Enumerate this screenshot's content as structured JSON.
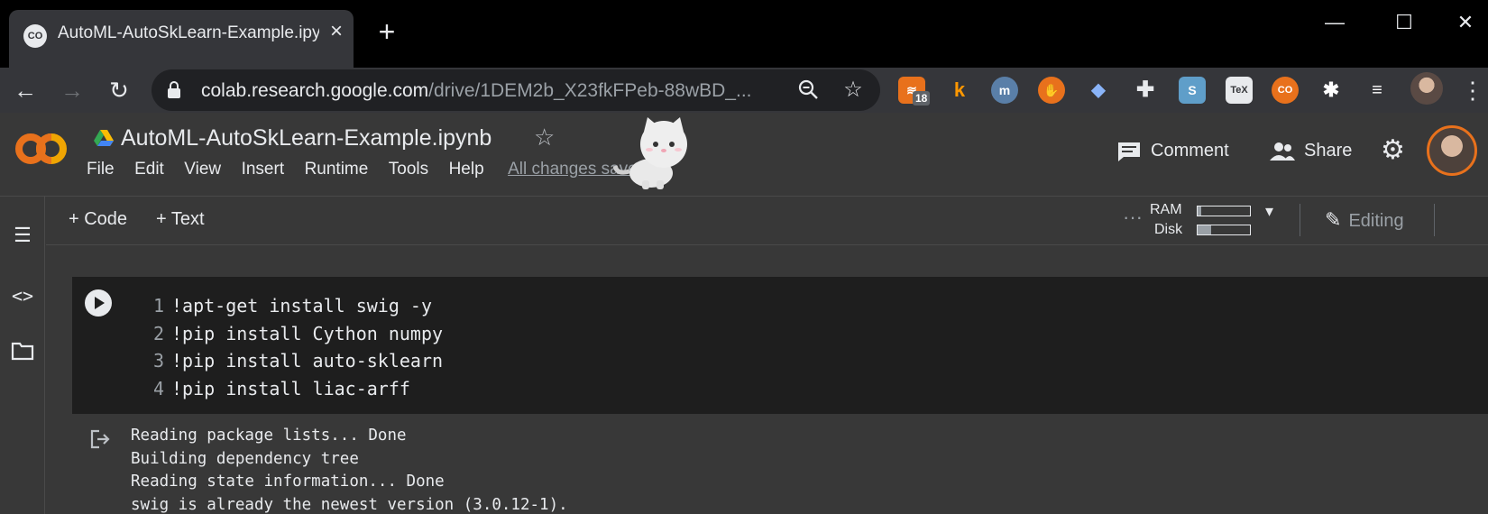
{
  "browser": {
    "tab": {
      "title": "AutoML-AutoSkLearn-Example.ipynb - Colaboratory",
      "favicon": "CO"
    },
    "new_tab_label": "+",
    "window_controls": {
      "minimize": "—",
      "maximize": "☐",
      "close": "✕"
    },
    "url": {
      "host": "colab.research.google.com",
      "path": "/drive/1DEM2b_X23fkFPeb-88wBD_..."
    },
    "extensions": [
      {
        "icon": "rss-icon",
        "badge": "18",
        "color": "#e8711c"
      },
      {
        "icon": "k-icon",
        "label": "k",
        "color": "#ff9800"
      },
      {
        "icon": "m-icon",
        "label": "m",
        "color": "#5a7fa8"
      },
      {
        "icon": "hand-icon",
        "color": "#e8711c"
      },
      {
        "icon": "graduation-cap-icon",
        "color": "#8ab4f8"
      },
      {
        "icon": "plus-cross-icon",
        "color": "#e8eaed"
      },
      {
        "icon": "s-icon",
        "label": "S",
        "color": "#5f9ec9"
      },
      {
        "icon": "tex-icon",
        "label": "TeX",
        "color": "#e8eaed"
      },
      {
        "icon": "colab-ext-icon",
        "label": "CO",
        "color": "#e8711c"
      }
    ]
  },
  "colab": {
    "logo": "CO",
    "notebook_title": "AutoML-AutoSkLearn-Example.ipynb",
    "menu": [
      "File",
      "Edit",
      "View",
      "Insert",
      "Runtime",
      "Tools",
      "Help"
    ],
    "save_status": "All changes saved",
    "comment_label": "Comment",
    "share_label": "Share",
    "add_code_label": "+ Code",
    "add_text_label": "+ Text",
    "ram_label": "RAM",
    "disk_label": "Disk",
    "ram_usage": 0.07,
    "disk_usage": 0.25,
    "editing_label": "Editing",
    "colors": {
      "logo_orange": "#e8711c",
      "cell_bg": "#1e1e1e",
      "page_bg": "#383838"
    }
  },
  "cell": {
    "lines": [
      {
        "num": "1",
        "code": "!apt-get install swig -y"
      },
      {
        "num": "2",
        "code": "!pip install Cython numpy"
      },
      {
        "num": "3",
        "code": "!pip install auto-sklearn"
      },
      {
        "num": "4",
        "code": "!pip install liac-arff"
      }
    ],
    "output": [
      "Reading package lists... Done",
      "Building dependency tree",
      "Reading state information... Done",
      "swig is already the newest version (3.0.12-1)."
    ]
  }
}
